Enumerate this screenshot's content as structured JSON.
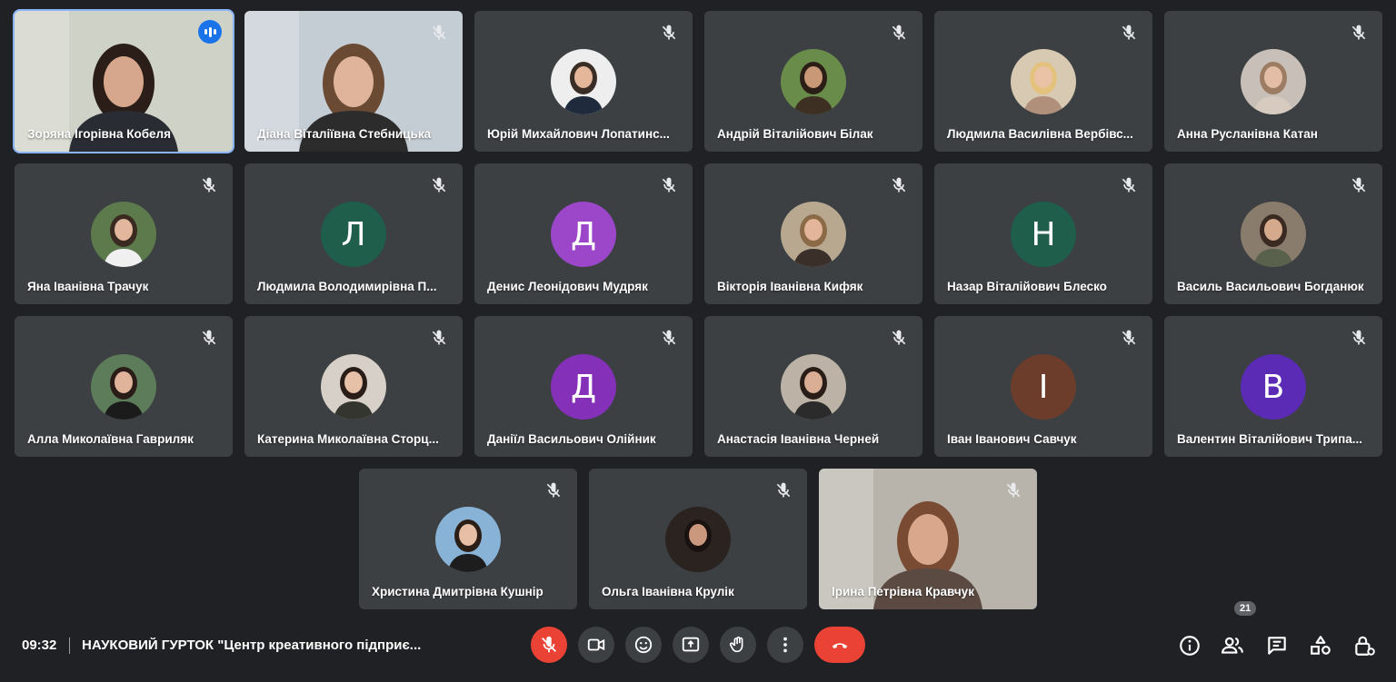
{
  "participants": [
    {
      "name": "Зоряна Ігорівна Кобеля",
      "avatar": "video-woman-room",
      "speaking": true
    },
    {
      "name": "Діана Віталіївна Стебницька",
      "avatar": "video-woman-cafe"
    },
    {
      "name": "Юрій Михайлович Лопатинс...",
      "avatar": "photo-man-suit"
    },
    {
      "name": "Андрій Віталійович Білак",
      "avatar": "photo-man-outdoor"
    },
    {
      "name": "Людмила Василівна Вербівс...",
      "avatar": "photo-woman-blonde"
    },
    {
      "name": "Анна Русланівна Катан",
      "avatar": "photo-woman-light"
    },
    {
      "name": "Яна Іванівна Трачук",
      "avatar": "photo-woman-white-dress"
    },
    {
      "name": "Людмила Володимирівна П...",
      "initial": "Л",
      "color": "#1e5e4a"
    },
    {
      "name": "Денис Леонідович Мудряк",
      "initial": "Д",
      "color": "#9c46c9"
    },
    {
      "name": "Вікторія Іванівна Кифяк",
      "avatar": "photo-woman-hair"
    },
    {
      "name": "Назар Віталійович Блеско",
      "initial": "Н",
      "color": "#1e5e4a"
    },
    {
      "name": "Василь Васильович Богданюк",
      "avatar": "photo-man-building"
    },
    {
      "name": "Алла Миколаївна Гавриляк",
      "avatar": "photo-woman-black-dress"
    },
    {
      "name": "Катерина Миколаївна Сторц...",
      "avatar": "photo-woman-dark-hair"
    },
    {
      "name": "Даніїл Васильович Олійник",
      "initial": "Д",
      "color": "#8430b8"
    },
    {
      "name": "Анастасія Іванівна Черней",
      "avatar": "photo-woman-street"
    },
    {
      "name": "Іван Іванович Савчук",
      "initial": "І",
      "color": "#6d3d2c"
    },
    {
      "name": "Валентин Віталійович Трипа...",
      "initial": "В",
      "color": "#5b2bb5"
    },
    {
      "name": "Христина Дмитрівна Кушнір",
      "avatar": "photo-woman-flowers"
    },
    {
      "name": "Ольга Іванівна Крулік",
      "avatar": "photo-woman-dark"
    },
    {
      "name": "Ірина Петрівна Кравчук",
      "avatar": "video-woman-stairs"
    }
  ],
  "bottombar": {
    "time": "09:32",
    "meeting_title": "НАУКОВИЙ ГУРТОК \"Центр креативного підприє...",
    "participants_count": "21"
  },
  "icons": {
    "controls": [
      "mic-off-icon",
      "camera-icon",
      "emoji-icon",
      "present-icon",
      "raise-hand-icon",
      "more-options-icon",
      "hang-up-icon"
    ],
    "right": [
      "info-icon",
      "people-icon",
      "chat-icon",
      "activities-icon",
      "host-controls-icon"
    ]
  },
  "colors": {
    "background": "#202124",
    "tile": "#3c4043",
    "accent": "#8ab4f8",
    "danger": "#ea4335"
  }
}
